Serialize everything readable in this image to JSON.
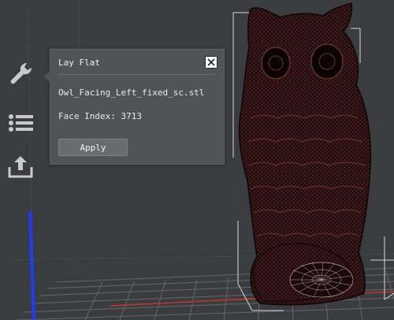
{
  "toolbar": {
    "items": [
      {
        "icon": "wrench-icon",
        "label": ""
      },
      {
        "icon": "list-icon",
        "label": ""
      },
      {
        "icon": "export-icon",
        "label": ""
      }
    ]
  },
  "dialog": {
    "title": "Lay Flat",
    "close_icon": "close-icon",
    "filename": "Owl_Facing_Left_fixed_sc.stl",
    "face_index_text": "Face Index: 3713",
    "apply_label": "Apply"
  },
  "colors": {
    "viewport_bg": "#3a3c3f",
    "dialog_bg": "#525355",
    "model_mesh": "#6b2a2a",
    "axis_blue": "#1a3cff",
    "axis_red": "#c0392b"
  }
}
